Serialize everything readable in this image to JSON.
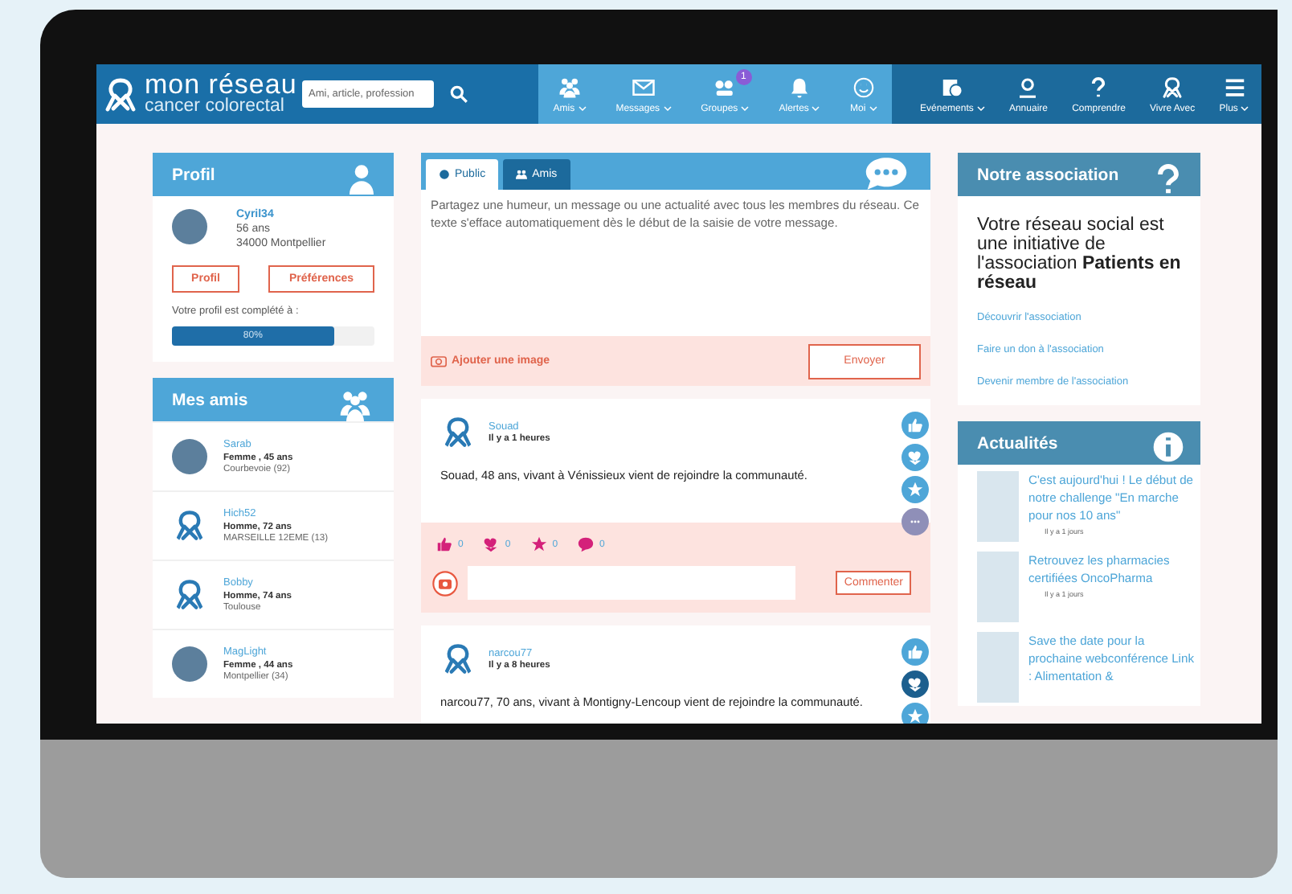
{
  "header": {
    "logo": {
      "line1": "mon réseau",
      "line2": "cancer colorectal"
    },
    "search": {
      "placeholder": "Ami, article, profession"
    },
    "nav_main": [
      {
        "kind": "friends",
        "label": "Amis",
        "dropdown": true
      },
      {
        "kind": "mail",
        "label": "Messages",
        "dropdown": true
      },
      {
        "kind": "groups",
        "label": "Groupes",
        "dropdown": true,
        "badge": "1"
      },
      {
        "kind": "bell",
        "label": "Alertes",
        "dropdown": true
      },
      {
        "kind": "smiley",
        "label": "Moi",
        "dropdown": true
      }
    ],
    "nav_site": [
      {
        "kind": "calendar",
        "label": "Evénements",
        "dropdown": true
      },
      {
        "kind": "pin",
        "label": "Annuaire",
        "dropdown": false
      },
      {
        "kind": "question",
        "label": "Comprendre",
        "dropdown": false
      },
      {
        "kind": "ribbon",
        "label": "Vivre Avec",
        "dropdown": false
      },
      {
        "kind": "menu",
        "label": "Plus",
        "dropdown": true
      }
    ]
  },
  "profile": {
    "title": "Profil",
    "name": "Cyril34",
    "age": "56 ans",
    "city": "34000 Montpellier",
    "buttons": [
      "Profil",
      "Préférences"
    ],
    "completion_label": "Votre profil est complété à :",
    "level": 0.8,
    "reading": "80%"
  },
  "friends": {
    "title": "Mes amis",
    "items": [
      {
        "kind": "photo",
        "name": "Sarab",
        "info": "Femme , 45 ans",
        "city": "Courbevoie (92)"
      },
      {
        "kind": "ribbon",
        "name": "Hich52",
        "info": "Homme, 72 ans",
        "city": "MARSEILLE 12EME (13)"
      },
      {
        "kind": "ribbon",
        "name": "Bobby",
        "info": "Homme, 74 ans",
        "city": "Toulouse"
      },
      {
        "kind": "photo",
        "name": "MagLight",
        "info": "Femme , 44 ans",
        "city": "Montpellier (34)"
      }
    ]
  },
  "composer": {
    "tabs": [
      {
        "label": "Public",
        "kind": "globe",
        "selected": true
      },
      {
        "label": "Amis",
        "kind": "friends",
        "selected": false
      }
    ],
    "placeholder": "Partagez une humeur, un message ou une actualité avec tous les membres du réseau. Ce texte s'efface automatiquement dès le début de la saisie de votre message.",
    "add_image": "Ajouter une image",
    "send": "Envoyer"
  },
  "posts": [
    {
      "author": "Souad",
      "time": "Il y a 1 heures",
      "text": "Souad, 48 ans, vivant à Vénissieux vient de rejoindre la communauté.",
      "side_actions": [
        {
          "kind": "like",
          "selected": false
        },
        {
          "kind": "love",
          "selected": false
        },
        {
          "kind": "star",
          "selected": false
        },
        {
          "kind": "more",
          "selected": false
        }
      ],
      "reactions": [
        {
          "kind": "like",
          "count": "0"
        },
        {
          "kind": "love",
          "count": "0"
        },
        {
          "kind": "star",
          "count": "0"
        },
        {
          "kind": "comment",
          "count": "0"
        }
      ],
      "comment_button": "Commenter"
    },
    {
      "author": "narcou77",
      "time": "Il y a 8 heures",
      "text": "narcou77, 70 ans, vivant à Montigny-Lencoup vient de rejoindre la communauté.",
      "side_actions": [
        {
          "kind": "like",
          "selected": false
        },
        {
          "kind": "love",
          "selected": true
        },
        {
          "kind": "star",
          "selected": false
        }
      ]
    }
  ],
  "association": {
    "title": "Notre association",
    "text": "Votre réseau social est une initiative de l'association **Patients en réseau**",
    "links": [
      "Découvrir l'association",
      "Faire un don à l'association",
      "Devenir membre de l'association"
    ]
  },
  "news": {
    "title": "Actualités",
    "items": [
      {
        "title": "C'est aujourd'hui ! Le début de notre challenge \"En marche pour nos 10 ans\"",
        "time": "Il y a 1 jours"
      },
      {
        "title": "Retrouvez les pharmacies certifiées OncoPharma",
        "time": "Il y a 1 jours"
      },
      {
        "title": "Save the date pour la prochaine webconférence Link : Alimentation &"
      }
    ]
  }
}
